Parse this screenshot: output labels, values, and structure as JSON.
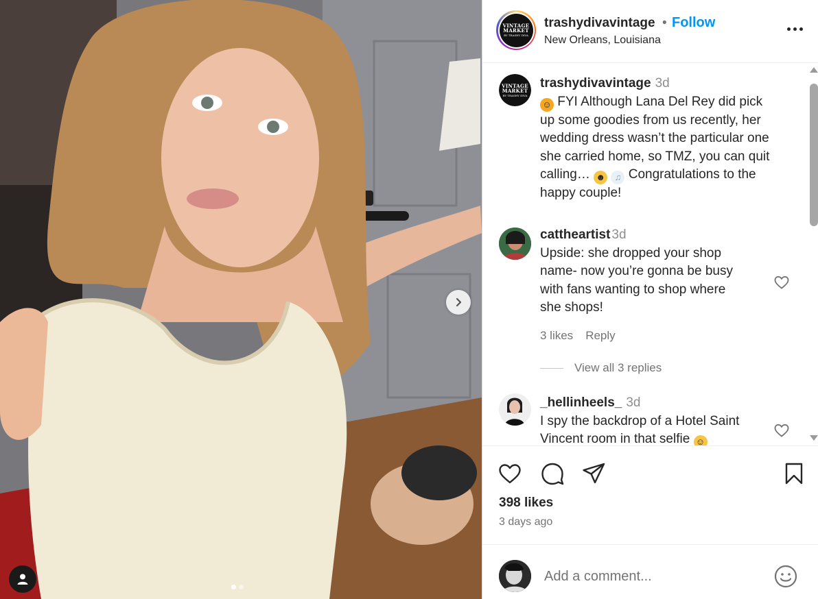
{
  "header": {
    "username": "trashydivavintage",
    "separator": "•",
    "follow_label": "Follow",
    "location": "New Orleans, Louisiana",
    "avatar_logo": [
      "VINTAGE",
      "MARKET",
      "BY TRASHY DIVA"
    ]
  },
  "post": {
    "carousel_dots": 2,
    "active_dot": 0
  },
  "comments": [
    {
      "username": "trashydivavintage",
      "time": "3d",
      "lines": [
        "FYI Although Lana Del Rey did pick",
        "up some goodies from us recently, her",
        "wedding dress wasn’t the particular one",
        "she carried home, so TMZ, you can quit",
        "calling…",
        "Congratulations to the",
        "happy couple!"
      ],
      "emojis": [
        "face-with-hand-over-mouth",
        "rolling-on-floor-laughing",
        "clinking-glasses"
      ]
    },
    {
      "username": "cattheartist",
      "time": "3d",
      "lines": [
        "Upside: she dropped your shop",
        "name- now you’re gonna be busy",
        "with fans wanting to shop where",
        "she shops!"
      ],
      "likes_label": "3 likes",
      "reply_label": "Reply",
      "view_replies_label": "View all 3 replies"
    },
    {
      "username": "_hellinheels_",
      "time": "3d",
      "lines": [
        "I spy the backdrop of a Hotel Saint",
        "Vincent room in that selfie"
      ],
      "emojis": [
        "smiling-face-with-hearts"
      ]
    }
  ],
  "actions": {
    "likes": "398 likes",
    "posted": "3 days ago"
  },
  "add_comment": {
    "placeholder": "Add a comment..."
  },
  "colors": {
    "follow": "#0095f6",
    "secondary_text": "#737373",
    "border": "#efefef"
  }
}
